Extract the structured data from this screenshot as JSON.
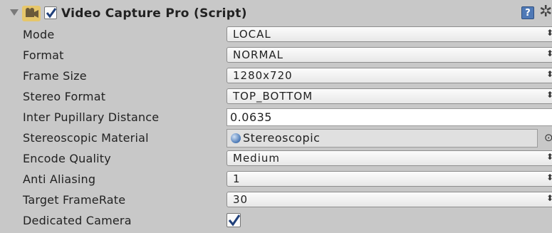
{
  "component": {
    "title": "Video Capture Pro (Script)",
    "enabled": true,
    "help_icon": "?",
    "gear_icon": "✲"
  },
  "fields": {
    "mode": {
      "label": "Mode",
      "value": "LOCAL"
    },
    "format": {
      "label": "Format",
      "value": "NORMAL"
    },
    "frame_size": {
      "label": "Frame Size",
      "value": "1280x720"
    },
    "stereo_format": {
      "label": "Stereo Format",
      "value": "TOP_BOTTOM"
    },
    "ipd": {
      "label": "Inter Pupillary Distance",
      "value": "0.0635"
    },
    "stereo_material": {
      "label": "Stereoscopic Material",
      "value": "Stereoscopic"
    },
    "encode_quality": {
      "label": "Encode Quality",
      "value": "Medium"
    },
    "anti_aliasing": {
      "label": "Anti Aliasing",
      "value": "1"
    },
    "target_framerate": {
      "label": "Target FrameRate",
      "value": "30"
    },
    "dedicated_camera": {
      "label": "Dedicated Camera",
      "checked": true
    }
  },
  "icons": {
    "dropdown_arrows": "⬍",
    "object_picker": "⊙"
  },
  "colors": {
    "panel_bg": "#c8c8c8",
    "component_icon": "#e6c66a",
    "help_icon": "#4f79b6",
    "check": "#1f3f7a"
  }
}
